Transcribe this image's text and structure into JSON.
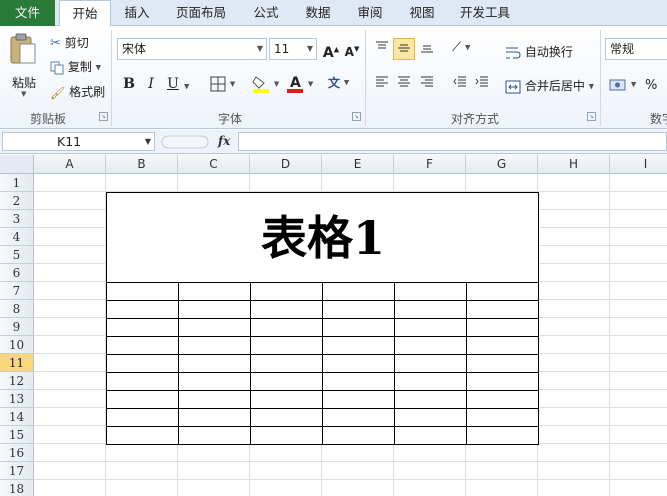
{
  "tabs": [
    "文件",
    "开始",
    "插入",
    "页面布局",
    "公式",
    "数据",
    "审阅",
    "视图",
    "开发工具"
  ],
  "ribbon": {
    "clipboard": {
      "paste": "粘贴",
      "cut": "剪切",
      "copy": "复制",
      "format_painter": "格式刷",
      "label": "剪贴板"
    },
    "font": {
      "name": "宋体",
      "size": "11",
      "bold": "B",
      "italic": "I",
      "underline": "U",
      "label": "字体"
    },
    "alignment": {
      "wrap": "自动换行",
      "merge": "合并后居中",
      "label": "对齐方式"
    },
    "number": {
      "format": "常规",
      "percent": "%",
      "label": "数字"
    }
  },
  "formula_bar": {
    "cell_ref": "K11",
    "fx": "fx",
    "value": ""
  },
  "sheet": {
    "columns": [
      "A",
      "B",
      "C",
      "D",
      "E",
      "F",
      "G",
      "H",
      "I"
    ],
    "rows": [
      "1",
      "2",
      "3",
      "4",
      "5",
      "6",
      "7",
      "8",
      "9",
      "10",
      "11",
      "12",
      "13",
      "14",
      "15",
      "16",
      "17",
      "18"
    ],
    "selected_row": "11",
    "table_title": "表格1",
    "table_grid": {
      "columns": 6,
      "body_rows": 9
    }
  },
  "colors": {
    "file_tab": "#2a7a3a",
    "selected_row_header": "#f9d77b",
    "active_button": "#fde6a2"
  }
}
